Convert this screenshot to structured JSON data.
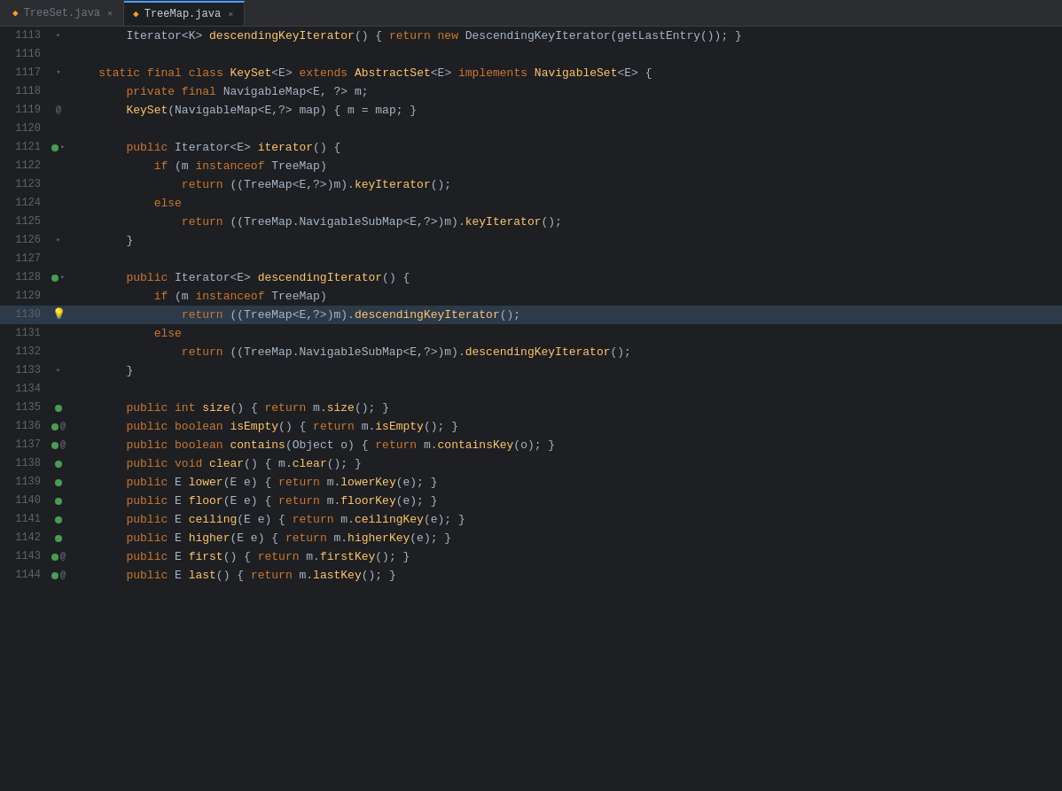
{
  "tabs": [
    {
      "id": "treeset",
      "label": "TreeSet.java",
      "active": false
    },
    {
      "id": "treemap",
      "label": "TreeMap.java",
      "active": true
    }
  ],
  "lines": [
    {
      "num": 1113,
      "gutter": "fold",
      "content": [
        {
          "t": "        ",
          "c": ""
        },
        {
          "t": "Iterator",
          "c": "type"
        },
        {
          "t": "<K> ",
          "c": "generic"
        },
        {
          "t": "descendingKeyIterator",
          "c": "method"
        },
        {
          "t": "() { ",
          "c": ""
        },
        {
          "t": "return",
          "c": "kw2"
        },
        {
          "t": " ",
          "c": ""
        },
        {
          "t": "new",
          "c": "new-kw"
        },
        {
          "t": " DescendingKeyIterator(getLastEntry()); }",
          "c": ""
        }
      ]
    },
    {
      "num": 1116,
      "gutter": "",
      "content": []
    },
    {
      "num": 1117,
      "gutter": "fold-open",
      "content": [
        {
          "t": "    ",
          "c": ""
        },
        {
          "t": "static",
          "c": "static-kw"
        },
        {
          "t": " ",
          "c": ""
        },
        {
          "t": "final",
          "c": "final-kw"
        },
        {
          "t": " ",
          "c": ""
        },
        {
          "t": "class",
          "c": "kw"
        },
        {
          "t": " ",
          "c": ""
        },
        {
          "t": "KeySet",
          "c": "classname"
        },
        {
          "t": "<E>",
          "c": "generic"
        },
        {
          "t": " ",
          "c": ""
        },
        {
          "t": "extends",
          "c": "kw"
        },
        {
          "t": " ",
          "c": ""
        },
        {
          "t": "AbstractSet",
          "c": "classname"
        },
        {
          "t": "<E>",
          "c": "generic"
        },
        {
          "t": " ",
          "c": ""
        },
        {
          "t": "implements",
          "c": "kw"
        },
        {
          "t": " ",
          "c": ""
        },
        {
          "t": "NavigableSet",
          "c": "interface"
        },
        {
          "t": "<E>",
          "c": "generic"
        },
        {
          "t": " {",
          "c": ""
        }
      ]
    },
    {
      "num": 1118,
      "gutter": "",
      "content": [
        {
          "t": "        ",
          "c": ""
        },
        {
          "t": "private",
          "c": "kw"
        },
        {
          "t": " ",
          "c": ""
        },
        {
          "t": "final",
          "c": "final-kw"
        },
        {
          "t": " NavigableMap<E, ?> m;",
          "c": ""
        }
      ]
    },
    {
      "num": 1119,
      "gutter": "at",
      "content": [
        {
          "t": "        ",
          "c": ""
        },
        {
          "t": "KeySet",
          "c": "method"
        },
        {
          "t": "(NavigableMap<E,?> map) { m = map; }",
          "c": ""
        }
      ]
    },
    {
      "num": 1120,
      "gutter": "",
      "content": []
    },
    {
      "num": 1121,
      "gutter": "green-fold",
      "content": [
        {
          "t": "        ",
          "c": ""
        },
        {
          "t": "public",
          "c": "kw"
        },
        {
          "t": " Iterator<E> ",
          "c": ""
        },
        {
          "t": "iterator",
          "c": "method"
        },
        {
          "t": "() {",
          "c": ""
        }
      ]
    },
    {
      "num": 1122,
      "gutter": "",
      "content": [
        {
          "t": "            ",
          "c": ""
        },
        {
          "t": "if",
          "c": "kw2"
        },
        {
          "t": " (m ",
          "c": ""
        },
        {
          "t": "instanceof",
          "c": "kw"
        },
        {
          "t": " TreeMap)",
          "c": ""
        }
      ]
    },
    {
      "num": 1123,
      "gutter": "",
      "content": [
        {
          "t": "                ",
          "c": ""
        },
        {
          "t": "return",
          "c": "kw2"
        },
        {
          "t": " ((TreeMap<E,?>)m).",
          "c": ""
        },
        {
          "t": "keyIterator",
          "c": "method"
        },
        {
          "t": "();",
          "c": ""
        }
      ]
    },
    {
      "num": 1124,
      "gutter": "",
      "content": [
        {
          "t": "            ",
          "c": ""
        },
        {
          "t": "else",
          "c": "kw2"
        }
      ]
    },
    {
      "num": 1125,
      "gutter": "",
      "content": [
        {
          "t": "                ",
          "c": ""
        },
        {
          "t": "return",
          "c": "kw2"
        },
        {
          "t": " ((TreeMap.NavigableSubMap<E,?>)m).",
          "c": ""
        },
        {
          "t": "keyIterator",
          "c": "method"
        },
        {
          "t": "();",
          "c": ""
        }
      ]
    },
    {
      "num": 1126,
      "gutter": "fold",
      "content": [
        {
          "t": "        ",
          "c": ""
        },
        {
          "t": "}",
          "c": ""
        }
      ]
    },
    {
      "num": 1127,
      "gutter": "",
      "content": []
    },
    {
      "num": 1128,
      "gutter": "green-fold",
      "content": [
        {
          "t": "        ",
          "c": ""
        },
        {
          "t": "public",
          "c": "kw"
        },
        {
          "t": " Iterator<E> ",
          "c": ""
        },
        {
          "t": "descendingIterator",
          "c": "method"
        },
        {
          "t": "() {",
          "c": ""
        }
      ]
    },
    {
      "num": 1129,
      "gutter": "",
      "content": [
        {
          "t": "            ",
          "c": ""
        },
        {
          "t": "if",
          "c": "kw2"
        },
        {
          "t": " (m ",
          "c": ""
        },
        {
          "t": "instanceof",
          "c": "kw"
        },
        {
          "t": " TreeMap)",
          "c": ""
        }
      ]
    },
    {
      "num": 1130,
      "gutter": "bulb",
      "content": [
        {
          "t": "                ",
          "c": ""
        },
        {
          "t": "return",
          "c": "kw2"
        },
        {
          "t": " ((TreeMap<E,?>)m).",
          "c": ""
        },
        {
          "t": "descendingKeyIterator",
          "c": "method"
        },
        {
          "t": "();",
          "c": ""
        }
      ],
      "active": true
    },
    {
      "num": 1131,
      "gutter": "",
      "content": [
        {
          "t": "            ",
          "c": ""
        },
        {
          "t": "else",
          "c": "kw2"
        }
      ]
    },
    {
      "num": 1132,
      "gutter": "",
      "content": [
        {
          "t": "                ",
          "c": ""
        },
        {
          "t": "return",
          "c": "kw2"
        },
        {
          "t": " ((TreeMap.NavigableSubMap<E,?>)m).",
          "c": ""
        },
        {
          "t": "descendingKeyIterator",
          "c": "method"
        },
        {
          "t": "();",
          "c": ""
        }
      ]
    },
    {
      "num": 1133,
      "gutter": "fold",
      "content": [
        {
          "t": "        ",
          "c": ""
        },
        {
          "t": "}",
          "c": ""
        }
      ]
    },
    {
      "num": 1134,
      "gutter": "",
      "content": []
    },
    {
      "num": 1135,
      "gutter": "green",
      "content": [
        {
          "t": "        ",
          "c": ""
        },
        {
          "t": "public",
          "c": "kw"
        },
        {
          "t": " ",
          "c": ""
        },
        {
          "t": "int",
          "c": "int-kw"
        },
        {
          "t": " ",
          "c": ""
        },
        {
          "t": "size",
          "c": "method"
        },
        {
          "t": "() { ",
          "c": ""
        },
        {
          "t": "return",
          "c": "kw2"
        },
        {
          "t": " m.",
          "c": ""
        },
        {
          "t": "size",
          "c": "method"
        },
        {
          "t": "(); }",
          "c": ""
        }
      ]
    },
    {
      "num": 1136,
      "gutter": "green-at",
      "content": [
        {
          "t": "        ",
          "c": ""
        },
        {
          "t": "public",
          "c": "kw"
        },
        {
          "t": " ",
          "c": ""
        },
        {
          "t": "boolean",
          "c": "boolean-kw"
        },
        {
          "t": " ",
          "c": ""
        },
        {
          "t": "isEmpty",
          "c": "method"
        },
        {
          "t": "() { ",
          "c": ""
        },
        {
          "t": "return",
          "c": "kw2"
        },
        {
          "t": " m.",
          "c": ""
        },
        {
          "t": "isEmpty",
          "c": "method"
        },
        {
          "t": "(); }",
          "c": ""
        }
      ]
    },
    {
      "num": 1137,
      "gutter": "green-at",
      "content": [
        {
          "t": "        ",
          "c": ""
        },
        {
          "t": "public",
          "c": "kw"
        },
        {
          "t": " ",
          "c": ""
        },
        {
          "t": "boolean",
          "c": "boolean-kw"
        },
        {
          "t": " ",
          "c": ""
        },
        {
          "t": "contains",
          "c": "method"
        },
        {
          "t": "(Object o) { ",
          "c": ""
        },
        {
          "t": "return",
          "c": "kw2"
        },
        {
          "t": " m.",
          "c": ""
        },
        {
          "t": "containsKey",
          "c": "method"
        },
        {
          "t": "(o); }",
          "c": ""
        }
      ]
    },
    {
      "num": 1138,
      "gutter": "green",
      "content": [
        {
          "t": "        ",
          "c": ""
        },
        {
          "t": "public",
          "c": "kw"
        },
        {
          "t": " ",
          "c": ""
        },
        {
          "t": "void",
          "c": "void-kw"
        },
        {
          "t": " ",
          "c": ""
        },
        {
          "t": "clear",
          "c": "method"
        },
        {
          "t": "() { m.",
          "c": ""
        },
        {
          "t": "clear",
          "c": "method"
        },
        {
          "t": "(); }",
          "c": ""
        }
      ]
    },
    {
      "num": 1139,
      "gutter": "green",
      "content": [
        {
          "t": "        ",
          "c": ""
        },
        {
          "t": "public",
          "c": "kw"
        },
        {
          "t": " E ",
          "c": ""
        },
        {
          "t": "lower",
          "c": "method"
        },
        {
          "t": "(E e) { ",
          "c": ""
        },
        {
          "t": "return",
          "c": "kw2"
        },
        {
          "t": " m.",
          "c": ""
        },
        {
          "t": "lowerKey",
          "c": "method"
        },
        {
          "t": "(e); }",
          "c": ""
        }
      ]
    },
    {
      "num": 1140,
      "gutter": "green",
      "content": [
        {
          "t": "        ",
          "c": ""
        },
        {
          "t": "public",
          "c": "kw"
        },
        {
          "t": " E ",
          "c": ""
        },
        {
          "t": "floor",
          "c": "method"
        },
        {
          "t": "(E e) { ",
          "c": ""
        },
        {
          "t": "return",
          "c": "kw2"
        },
        {
          "t": " m.",
          "c": ""
        },
        {
          "t": "floorKey",
          "c": "method"
        },
        {
          "t": "(e); }",
          "c": ""
        }
      ]
    },
    {
      "num": 1141,
      "gutter": "green",
      "content": [
        {
          "t": "        ",
          "c": ""
        },
        {
          "t": "public",
          "c": "kw"
        },
        {
          "t": " E ",
          "c": ""
        },
        {
          "t": "ceiling",
          "c": "method"
        },
        {
          "t": "(E e) { ",
          "c": ""
        },
        {
          "t": "return",
          "c": "kw2"
        },
        {
          "t": " m.",
          "c": ""
        },
        {
          "t": "ceilingKey",
          "c": "method"
        },
        {
          "t": "(e); }",
          "c": ""
        }
      ]
    },
    {
      "num": 1142,
      "gutter": "green",
      "content": [
        {
          "t": "        ",
          "c": ""
        },
        {
          "t": "public",
          "c": "kw"
        },
        {
          "t": " E ",
          "c": ""
        },
        {
          "t": "higher",
          "c": "method"
        },
        {
          "t": "(E e) { ",
          "c": ""
        },
        {
          "t": "return",
          "c": "kw2"
        },
        {
          "t": " m.",
          "c": ""
        },
        {
          "t": "higherKey",
          "c": "method"
        },
        {
          "t": "(e); }",
          "c": ""
        }
      ]
    },
    {
      "num": 1143,
      "gutter": "green-at",
      "content": [
        {
          "t": "        ",
          "c": ""
        },
        {
          "t": "public",
          "c": "kw"
        },
        {
          "t": " E ",
          "c": ""
        },
        {
          "t": "first",
          "c": "method"
        },
        {
          "t": "() { ",
          "c": ""
        },
        {
          "t": "return",
          "c": "kw2"
        },
        {
          "t": " m.",
          "c": ""
        },
        {
          "t": "firstKey",
          "c": "method"
        },
        {
          "t": "(); }",
          "c": ""
        }
      ]
    },
    {
      "num": 1144,
      "gutter": "green-at",
      "content": [
        {
          "t": "        ",
          "c": ""
        },
        {
          "t": "public",
          "c": "kw"
        },
        {
          "t": " E ",
          "c": ""
        },
        {
          "t": "last",
          "c": "method"
        },
        {
          "t": "() { ",
          "c": ""
        },
        {
          "t": "return",
          "c": "kw2"
        },
        {
          "t": " m.",
          "c": ""
        },
        {
          "t": "lastKey",
          "c": "method"
        },
        {
          "t": "(); }",
          "c": ""
        }
      ]
    }
  ]
}
